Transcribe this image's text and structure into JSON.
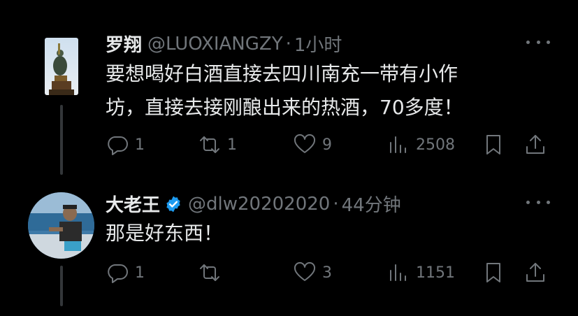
{
  "tweets": [
    {
      "name": "罗翔",
      "handle": "@LUOXIANGZY",
      "separator": "·",
      "time": "1小时",
      "verified": false,
      "text_line1": "要想喝好白酒直接去四川南充一带有小作",
      "text_line2": "坊，直接去接刚酿出来的热酒，70多度！",
      "replies": "1",
      "reposts": "1",
      "likes": "9",
      "views": "2508"
    },
    {
      "name": "大老王",
      "handle": "@dlw20202020",
      "separator": "·",
      "time": "44分钟",
      "verified": true,
      "text_line1": "那是好东西！",
      "replies": "1",
      "reposts": "",
      "likes": "3",
      "views": "1151"
    }
  ],
  "colors": {
    "background": "#000000",
    "text": "#e7e9ea",
    "muted": "#71767b",
    "verified": "#1d9bf0",
    "thread_line": "#333639"
  },
  "icons": [
    "reply-icon",
    "repost-icon",
    "like-icon",
    "views-icon",
    "bookmark-icon",
    "share-icon",
    "more-icon",
    "verified-icon"
  ]
}
